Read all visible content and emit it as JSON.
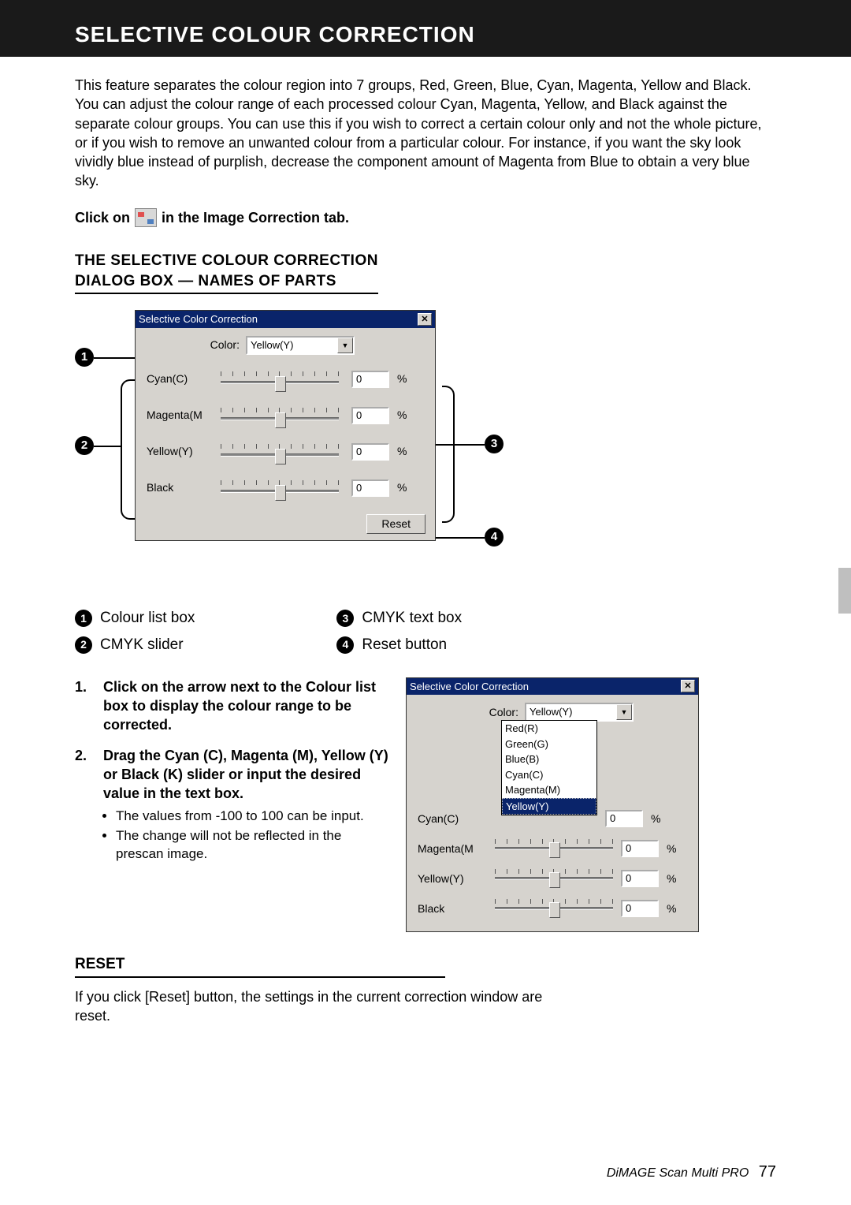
{
  "header": {
    "title": "SELECTIVE COLOUR CORRECTION"
  },
  "intro": "This feature separates the colour region into 7 groups, Red, Green, Blue, Cyan, Magenta, Yellow and Black. You can adjust the colour range of each processed colour Cyan, Magenta, Yellow, and Black against the separate colour groups. You can use this if you wish to correct a certain colour only and not the whole picture, or if you wish to remove an unwanted colour from a particular colour. For instance, if you want the sky look vividly blue instead of purplish, decrease the component amount of Magenta from Blue to obtain a very blue sky.",
  "clickline": {
    "before": "Click on",
    "after": "in the Image Correction tab."
  },
  "section1_heading_l1": "THE SELECTIVE COLOUR CORRECTION",
  "section1_heading_l2": "DIALOG BOX — NAMES OF PARTS",
  "dialog1": {
    "title": "Selective Color Correction",
    "color_label": "Color:",
    "selected": "Yellow(Y)",
    "rows": [
      {
        "label": "Cyan(C)",
        "value": "0",
        "pct": "%"
      },
      {
        "label": "Magenta(M",
        "value": "0",
        "pct": "%"
      },
      {
        "label": "Yellow(Y)",
        "value": "0",
        "pct": "%"
      },
      {
        "label": "Black",
        "value": "0",
        "pct": "%"
      }
    ],
    "reset": "Reset"
  },
  "legend": {
    "1": "Colour list box",
    "2": "CMYK slider",
    "3": "CMYK text box",
    "4": "Reset button"
  },
  "steps": {
    "s1_num": "1.",
    "s1": "Click on the arrow next to the Colour list box to display the colour range to be corrected.",
    "s2_num": "2.",
    "s2": "Drag the Cyan (C), Magenta (M), Yellow (Y) or Black (K) slider or input the desired value in the text box.",
    "b1": "The values from -100 to 100 can be input.",
    "b2": "The change will not be reflected in the prescan image."
  },
  "dialog2": {
    "title": "Selective Color Correction",
    "color_label": "Color:",
    "selected": "Yellow(Y)",
    "options": [
      "Red(R)",
      "Green(G)",
      "Blue(B)",
      "Cyan(C)",
      "Magenta(M)",
      "Yellow(Y)"
    ],
    "rows": [
      {
        "label": "Cyan(C)",
        "value": "0",
        "pct": "%"
      },
      {
        "label": "Magenta(M",
        "value": "0",
        "pct": "%"
      },
      {
        "label": "Yellow(Y)",
        "value": "0",
        "pct": "%"
      },
      {
        "label": "Black",
        "value": "0",
        "pct": "%"
      }
    ]
  },
  "reset_heading": "RESET",
  "reset_text": "If you click [Reset] button, the settings in the current correction window are reset.",
  "footer": {
    "product": "DiMAGE Scan Multi PRO",
    "page": "77"
  }
}
